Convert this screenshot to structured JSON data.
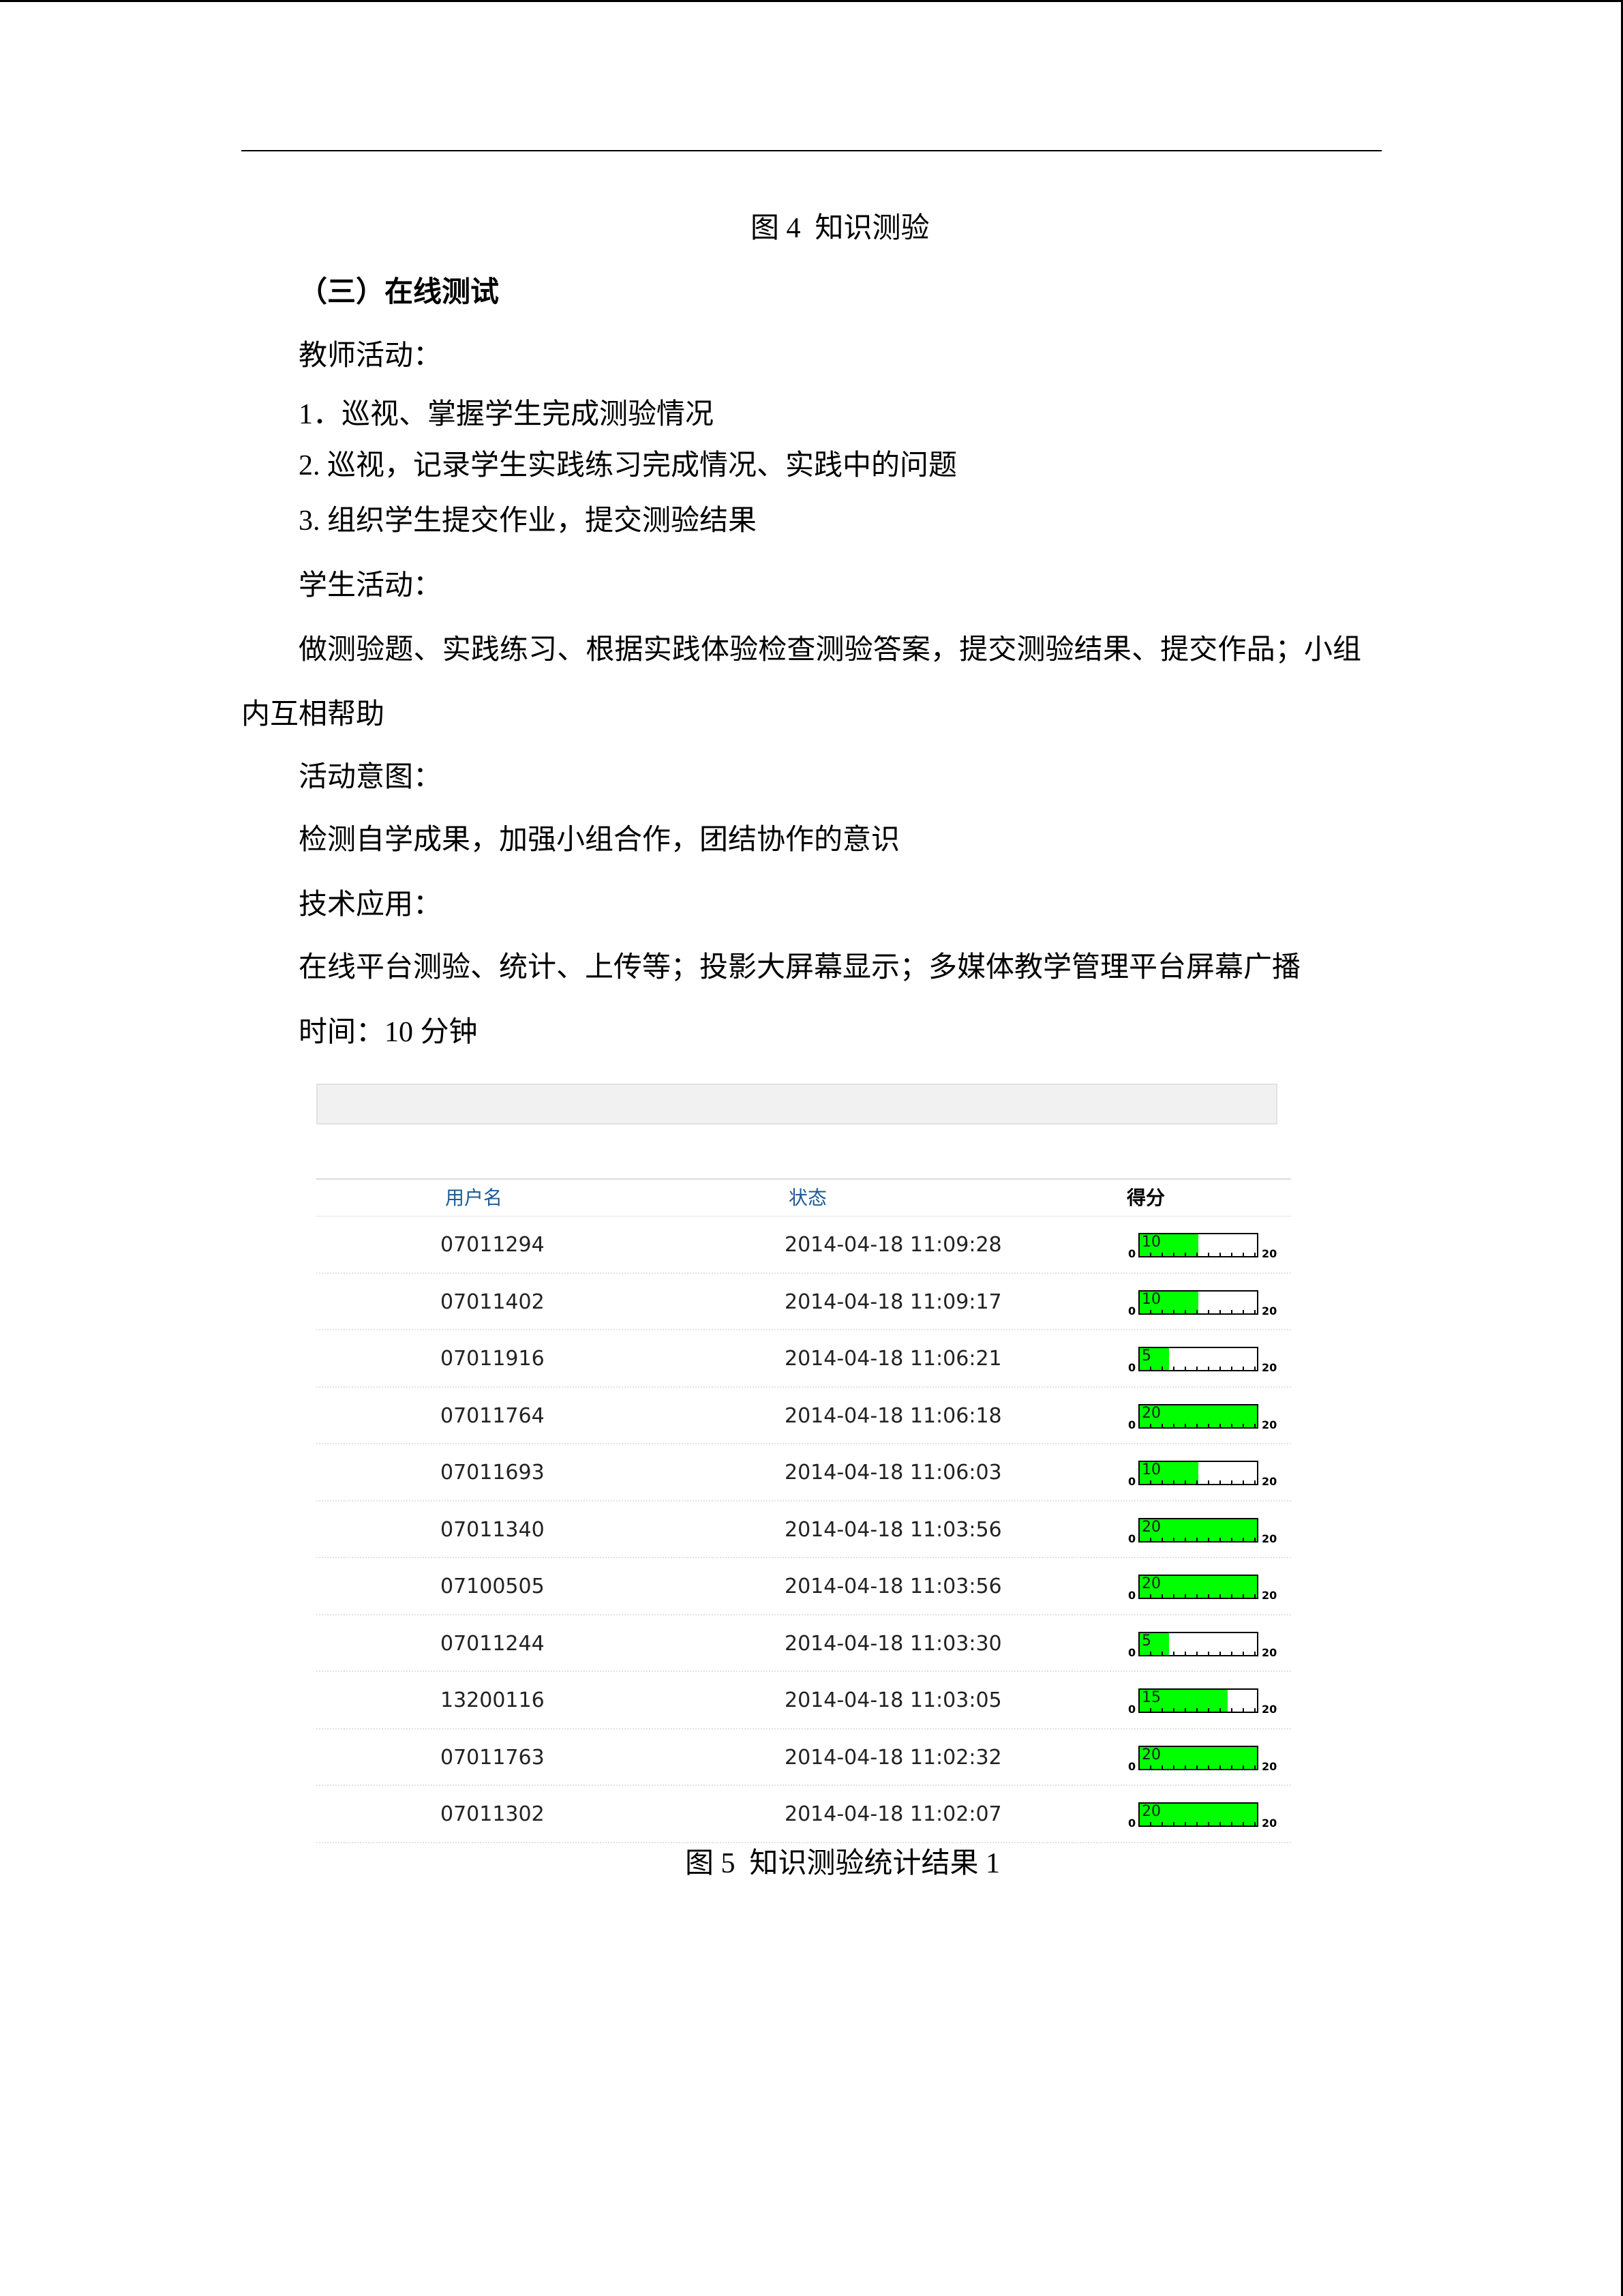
{
  "figure4_caption": "图 4  知识测验",
  "section_heading": "（三）在线测试",
  "teacher_label": "教师活动：",
  "teacher_items": [
    "1．巡视、掌握学生完成测验情况",
    "2. 巡视，记录学生实践练习完成情况、实践中的问题",
    "3. 组织学生提交作业，提交测验结果"
  ],
  "student_label": "学生活动：",
  "student_text_lines": [
    "做测验题、实践练习、根据实践体验检查测验答案，提交测验结果、提交作品；小组",
    "内互相帮助"
  ],
  "intent_label": "活动意图：",
  "intent_text": "检测自学成果，加强小组合作，团结协作的意识",
  "tech_label": "技术应用：",
  "tech_text": "在线平台测验、统计、上传等；投影大屏幕显示；多媒体教学管理平台屏幕广播",
  "time_text": "时间：10 分钟",
  "colors": {
    "header_link": "#1d5a96",
    "score_fill": "#00ff00"
  },
  "results_table": {
    "headers": {
      "username": "用户名",
      "status": "状态",
      "score": "得分"
    },
    "score_scale": {
      "min": 0,
      "max": 20,
      "min_label": "0",
      "max_label": "20"
    },
    "rows": [
      {
        "username": "07011294",
        "status": "2014-04-18 11:09:28",
        "score": 10
      },
      {
        "username": "07011402",
        "status": "2014-04-18 11:09:17",
        "score": 10
      },
      {
        "username": "07011916",
        "status": "2014-04-18 11:06:21",
        "score": 5
      },
      {
        "username": "07011764",
        "status": "2014-04-18 11:06:18",
        "score": 20
      },
      {
        "username": "07011693",
        "status": "2014-04-18 11:06:03",
        "score": 10
      },
      {
        "username": "07011340",
        "status": "2014-04-18 11:03:56",
        "score": 20
      },
      {
        "username": "07100505",
        "status": "2014-04-18 11:03:56",
        "score": 20
      },
      {
        "username": "07011244",
        "status": "2014-04-18 11:03:30",
        "score": 5
      },
      {
        "username": "13200116",
        "status": "2014-04-18 11:03:05",
        "score": 15
      },
      {
        "username": "07011763",
        "status": "2014-04-18 11:02:32",
        "score": 20
      },
      {
        "username": "07011302",
        "status": "2014-04-18 11:02:07",
        "score": 20
      }
    ]
  },
  "figure5_caption": "图 5  知识测验统计结果 1"
}
